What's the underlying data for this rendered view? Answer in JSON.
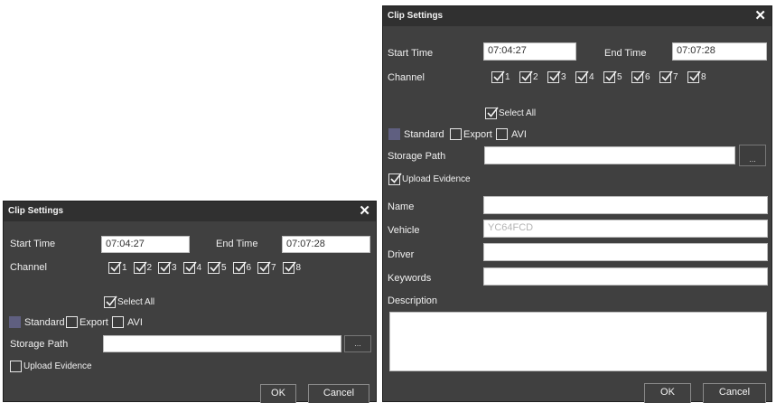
{
  "dialog": {
    "title": "Clip Settings",
    "close_glyph": "✕",
    "start_time_label": "Start Time",
    "start_time": "07:04:27",
    "end_time_label": "End Time",
    "end_time": "07:07:28",
    "channel_label": "Channel",
    "channels": [
      "1",
      "2",
      "3",
      "4",
      "5",
      "6",
      "7",
      "8"
    ],
    "select_all_label": "Select All",
    "format_standard": "Standard",
    "format_export": "Export",
    "format_avi": "AVI",
    "storage_path_label": "Storage Path",
    "storage_path": "",
    "browse_label": "...",
    "upload_evidence_label": "Upload Evidence",
    "ok_label": "OK",
    "cancel_label": "Cancel"
  },
  "evidence": {
    "name_label": "Name",
    "name": "",
    "vehicle_label": "Vehicle",
    "vehicle": "YC64FCD",
    "driver_label": "Driver",
    "driver": "",
    "keywords_label": "Keywords",
    "keywords": "",
    "description_label": "Description",
    "description": ""
  },
  "state": {
    "small_upload_evidence_checked": false,
    "large_upload_evidence_checked": true,
    "channels_checked": true,
    "select_all_checked": true,
    "selected_format": "Standard"
  },
  "colors": {
    "dialog_bg": "#404040",
    "titlebar_bg": "#303030",
    "selected_radio": "#5f5f80"
  }
}
